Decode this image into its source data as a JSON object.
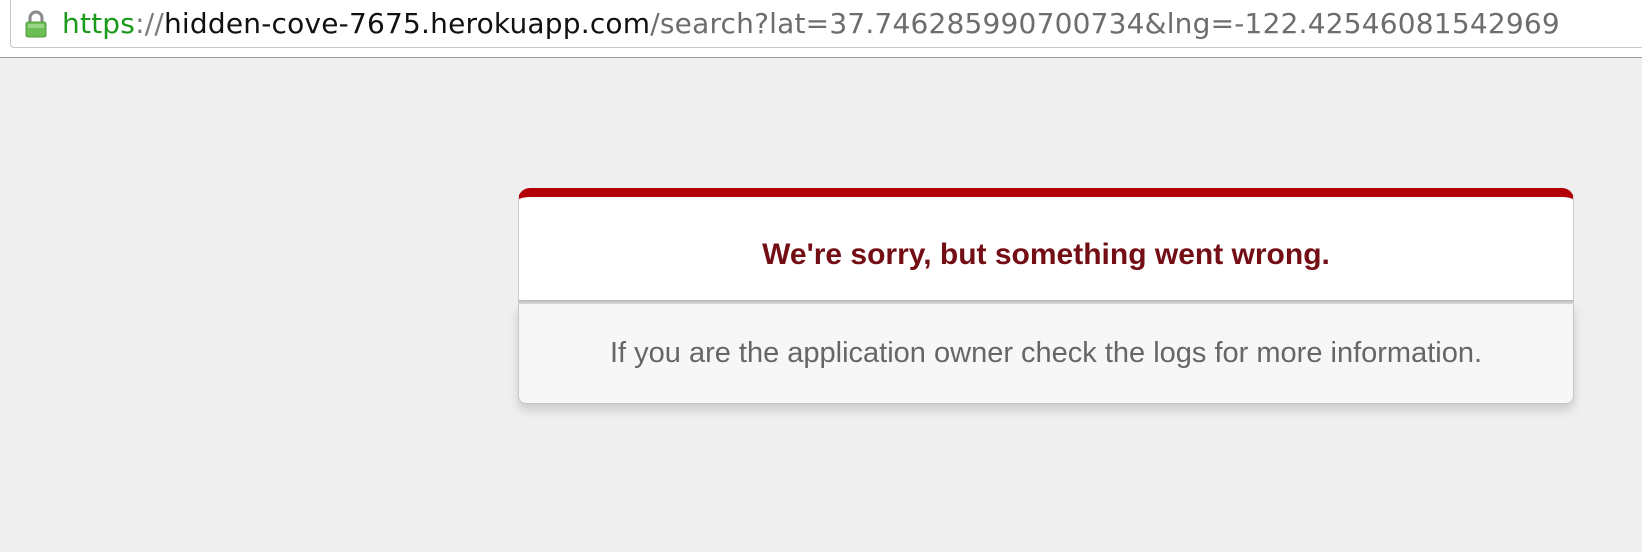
{
  "browser": {
    "address_bar": {
      "scheme": "https",
      "separator": "://",
      "host": "hidden-cove-7675.herokuapp.com",
      "path": "/search?lat=37.746285990700734&lng=-122.42546081542969",
      "secure_icon": "lock-icon",
      "secure_color": "#5bb14a"
    }
  },
  "error_page": {
    "title": "We're sorry, but something went wrong.",
    "message": "If you are the application owner check the logs for more information.",
    "accent_color": "#b10008",
    "title_color": "#730e15"
  }
}
